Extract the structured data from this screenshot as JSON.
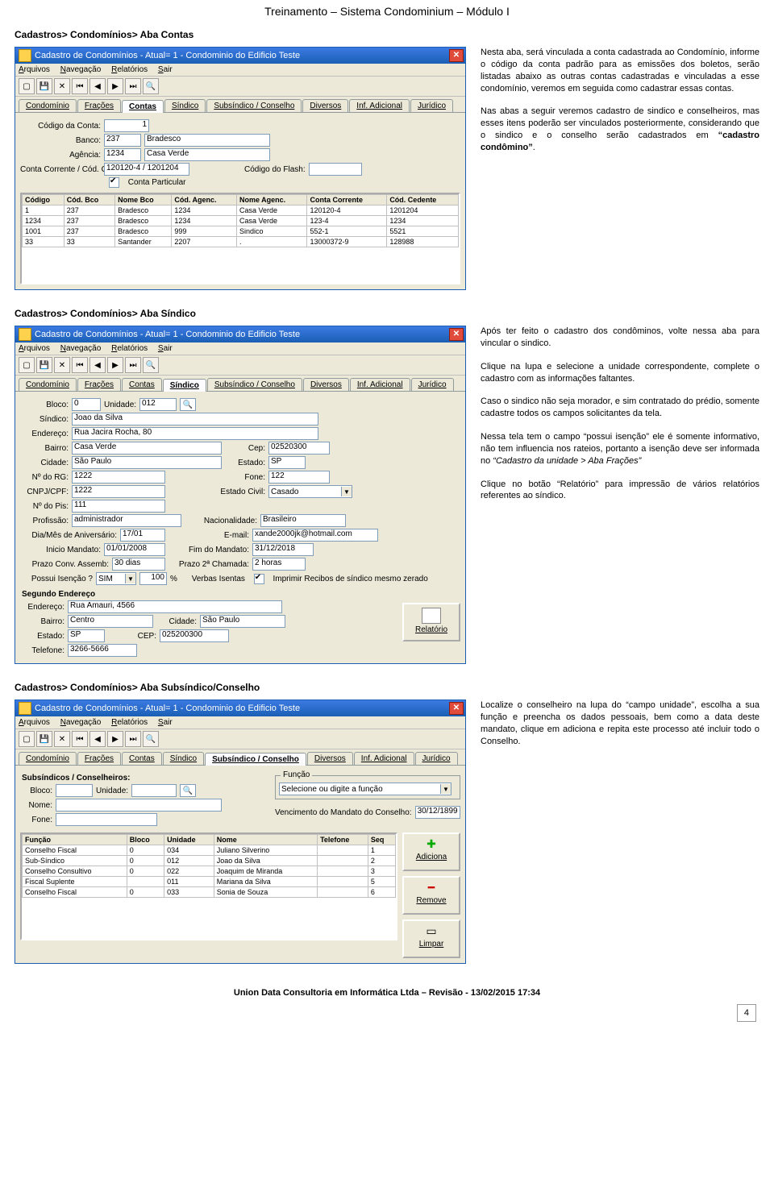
{
  "header": "Treinamento – Sistema Condominium – Módulo I",
  "footer": "Union Data Consultoria em Informática Ltda – Revisão - 13/02/2015 17:34",
  "pagenum": "4",
  "sec1": {
    "title": "Cadastros> Condomínios> Aba Contas",
    "p1": "Nesta aba, será vinculada a conta cadastrada ao Condomínio, informe o código da conta padrão para as emissões dos boletos, serão listadas abaixo as outras contas cadastradas e vinculadas a esse condomínio, veremos em seguida como cadastrar essas contas.",
    "p2a": "Nas abas a seguir veremos cadastro de sindico e conselheiros, mas esses itens poderão ser vinculados posteriormente, considerando que o sindico e o conselho serão cadastrados em ",
    "p2b": "“cadastro condômino”",
    "p2c": "."
  },
  "sec2": {
    "title": "Cadastros> Condomínios> Aba Síndico",
    "p1": "Após ter feito o cadastro dos condôminos, volte nessa aba para vincular o sindico.",
    "p2": "Clique na lupa e selecione a unidade correspondente, complete o cadastro com as informações faltantes.",
    "p3": "Caso o sindico não seja morador, e sim contratado do prédio, somente cadastre todos os campos solicitantes da tela.",
    "p4a": "Nessa tela tem o campo “possui isenção” ele é somente informativo, não tem influencia nos rateios, portanto a isenção deve ser informada no ",
    "p4b": "“Cadastro da unidade > Aba Frações”",
    "p5": "Clique no botão “Relatório” para impressão de vários relatórios referentes ao síndico."
  },
  "sec3": {
    "title": "Cadastros> Condomínios> Aba Subsíndico/Conselho",
    "p1": "Localize o conselheiro na lupa do “campo unidade”, escolha a sua função e preencha os dados pessoais, bem como a data deste mandato, clique em adiciona e repita este processo até incluir todo o Conselho."
  },
  "win": {
    "title": "Cadastro de Condomínios - Atual= 1 - Condominio do Edificio Teste",
    "menu": {
      "m1": "Arquivos",
      "m2": "Navegação",
      "m3": "Relatórios",
      "m4": "Sair"
    },
    "tabs": {
      "t1": "Condomínio",
      "t2": "Frações",
      "t3": "Contas",
      "t4": "Síndico",
      "t5": "Subsíndico / Conselho",
      "t6": "Diversos",
      "t7": "Inf. Adicional",
      "t8": "Jurídico"
    }
  },
  "contas": {
    "lbl_codigo": "Código da Conta:",
    "val_codigo": "1",
    "lbl_banco": "Banco:",
    "val_banco_cod": "237",
    "val_banco_nome": "Bradesco",
    "lbl_agencia": "Agência:",
    "val_agencia": "1234",
    "val_agencia_nome": "Casa Verde",
    "lbl_cc": "Conta Corrente / Cód. Cedente:",
    "val_cc": "120120-4  / 1201204",
    "lbl_flash": "Código do Flash:",
    "val_flash": "",
    "chk": "Conta Particular",
    "th": {
      "c1": "Código",
      "c2": "Cód. Bco",
      "c3": "Nome Bco",
      "c4": "Cód. Agenc.",
      "c5": "Nome Agenc.",
      "c6": "Conta Corrente",
      "c7": "Cód. Cedente"
    },
    "rows": [
      {
        "c1": "1",
        "c2": "237",
        "c3": "Bradesco",
        "c4": "1234",
        "c5": "Casa Verde",
        "c6": "120120-4",
        "c7": "1201204"
      },
      {
        "c1": "1234",
        "c2": "237",
        "c3": "Bradesco",
        "c4": "1234",
        "c5": "Casa Verde",
        "c6": "123-4",
        "c7": "1234"
      },
      {
        "c1": "1001",
        "c2": "237",
        "c3": "Bradesco",
        "c4": "999",
        "c5": "Sindico",
        "c6": "552-1",
        "c7": "5521"
      },
      {
        "c1": "33",
        "c2": "33",
        "c3": "Santander",
        "c4": "2207",
        "c5": ".",
        "c6": "13000372-9",
        "c7": "128988"
      }
    ]
  },
  "sindico": {
    "lbl_bloco": "Bloco:",
    "val_bloco": "0",
    "lbl_unidade": "Unidade:",
    "val_unidade": "012",
    "lbl_sindico": "Síndico:",
    "val_sindico": "Joao da Silva",
    "lbl_end": "Endereço:",
    "val_end": "Rua Jacira Rocha, 80",
    "lbl_bairro": "Bairro:",
    "val_bairro": "Casa Verde",
    "lbl_cep": "Cep:",
    "val_cep": "02520300",
    "lbl_cidade": "Cidade:",
    "val_cidade": "São Paulo",
    "lbl_estado": "Estado:",
    "val_estado": "SP",
    "lbl_rg": "Nº do RG:",
    "val_rg": "1222",
    "lbl_fone": "Fone:",
    "val_fone": "122",
    "lbl_cpf": "CNPJ/CPF:",
    "val_cpf": "1222",
    "lbl_civil": "Estado Civil:",
    "val_civil": "Casado",
    "lbl_pis": "Nº do Pis:",
    "val_pis": "111",
    "lbl_prof": "Profissão:",
    "val_prof": "administrador",
    "lbl_nac": "Nacionalidade:",
    "val_nac": "Brasileiro",
    "lbl_aniv": "Dia/Mês de Aniversário:",
    "val_aniv": "17/01",
    "lbl_email": "E-mail:",
    "val_email": "xande2000jk@hotmail.com",
    "lbl_ini": "Inicio Mandato:",
    "val_ini": "01/01/2008",
    "lbl_fim": "Fim do Mandato:",
    "val_fim": "31/12/2018",
    "lbl_prazo": "Prazo Conv. Assemb:",
    "val_prazo": "30 dias",
    "lbl_prazo2": "Prazo 2ª Chamada:",
    "val_prazo2": "2 horas",
    "lbl_isencao": "Possui Isenção ?",
    "val_isencao": "SIM",
    "val_pct": "100",
    "lbl_pct": "%",
    "lbl_verbas": "Verbas Isentas",
    "chk_recibo": "Imprimir Recibos de síndico mesmo zerado",
    "grp": "Segundo Endereço",
    "lbl_end2": "Endereço:",
    "val_end2": "Rua Amauri, 4566",
    "lbl_bairro2": "Bairro:",
    "val_bairro2": "Centro",
    "lbl_cidade2": "Cidade:",
    "val_cidade2": "São Paulo",
    "lbl_estado2": "Estado:",
    "val_estado2": "SP",
    "lbl_cep2": "CEP:",
    "val_cep2": "025200300",
    "lbl_tel2": "Telefone:",
    "val_tel2": "3266-5666",
    "btn_rel": "Relatório"
  },
  "conselho": {
    "grp": "Subsíndicos / Conselheiros:",
    "lbl_bloco": "Bloco:",
    "lbl_unid": "Unidade:",
    "lbl_nome": "Nome:",
    "lbl_fone": "Fone:",
    "grp_func": "Função",
    "combo_func": "Selecione ou digite a função",
    "lbl_venc": "Vencimento do Mandato do Conselho:",
    "val_venc": "30/12/1899",
    "th": {
      "c1": "Função",
      "c2": "Bloco",
      "c3": "Unidade",
      "c4": "Nome",
      "c5": "Telefone",
      "c6": "Seq"
    },
    "rows": [
      {
        "c1": "Conselho Fiscal",
        "c2": "0",
        "c3": "034",
        "c4": "Juliano Silverino",
        "c5": "",
        "c6": "1"
      },
      {
        "c1": "Sub-Síndico",
        "c2": "0",
        "c3": "012",
        "c4": "Joao da Silva",
        "c5": "",
        "c6": "2"
      },
      {
        "c1": "Conselho Consultivo",
        "c2": "0",
        "c3": "022",
        "c4": "Joaquim de Miranda",
        "c5": "",
        "c6": "3"
      },
      {
        "c1": "Fiscal Suplente",
        "c2": "",
        "c3": "011",
        "c4": "Mariana da Silva",
        "c5": "",
        "c6": "5"
      },
      {
        "c1": "Conselho Fiscal",
        "c2": "0",
        "c3": "033",
        "c4": "Sonia de Souza",
        "c5": "",
        "c6": "6"
      }
    ],
    "btn_add": "Adiciona",
    "btn_rem": "Remove",
    "btn_clr": "Limpar"
  }
}
